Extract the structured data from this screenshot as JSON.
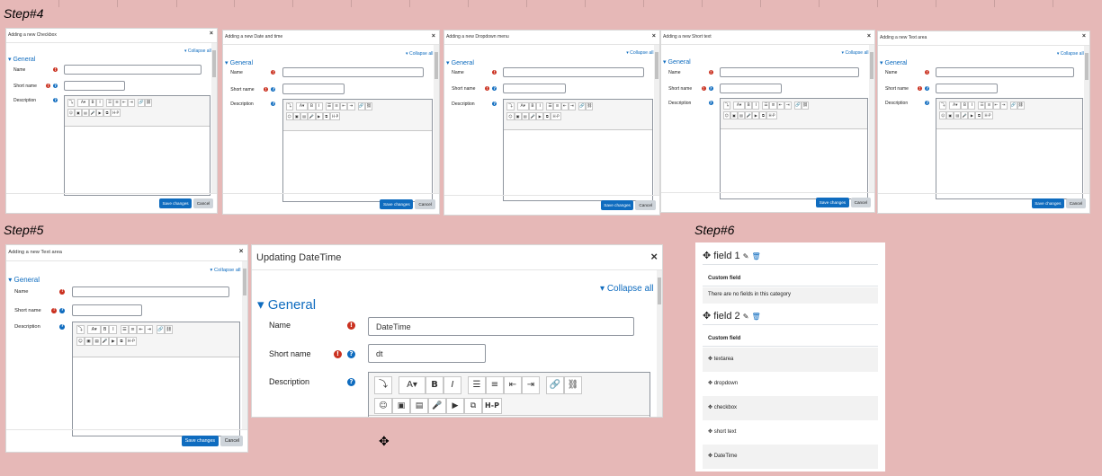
{
  "steps": {
    "s4": "Step#4",
    "s5": "Step#5",
    "s6": "Step#6"
  },
  "common": {
    "collapse_all": "Collapse all",
    "general": "General",
    "name_label": "Name",
    "short_name_label": "Short name",
    "description_label": "Description",
    "save": "Save changes",
    "cancel": "Cancel",
    "close": "×"
  },
  "dialogs": {
    "d1": {
      "title": "Adding a new Checkbox"
    },
    "d2": {
      "title": "Adding a new Date and time"
    },
    "d3": {
      "title": "Adding a new Dropdown menu"
    },
    "d4": {
      "title": "Adding a new Short text"
    },
    "d5": {
      "title": "Adding a new Text area"
    },
    "d6": {
      "title": "Adding a new Text area"
    },
    "d7": {
      "title": "Updating DateTime",
      "name_value": "DateTime",
      "short_value": "dt"
    }
  },
  "step6": {
    "categories": [
      {
        "name": "field 1",
        "header": "Custom field",
        "empty": "There are no fields in this category"
      },
      {
        "name": "field 2",
        "header": "Custom field",
        "fields": [
          "textarea",
          "dropdown",
          "checkbox",
          "short text",
          "DateTime"
        ]
      }
    ]
  },
  "icons": [
    "bold-icon",
    "italic-icon",
    "list-icon",
    "link-icon",
    "image-icon",
    "video-icon",
    "edit-icon",
    "delete-icon",
    "move-icon",
    "cursor-icon"
  ]
}
